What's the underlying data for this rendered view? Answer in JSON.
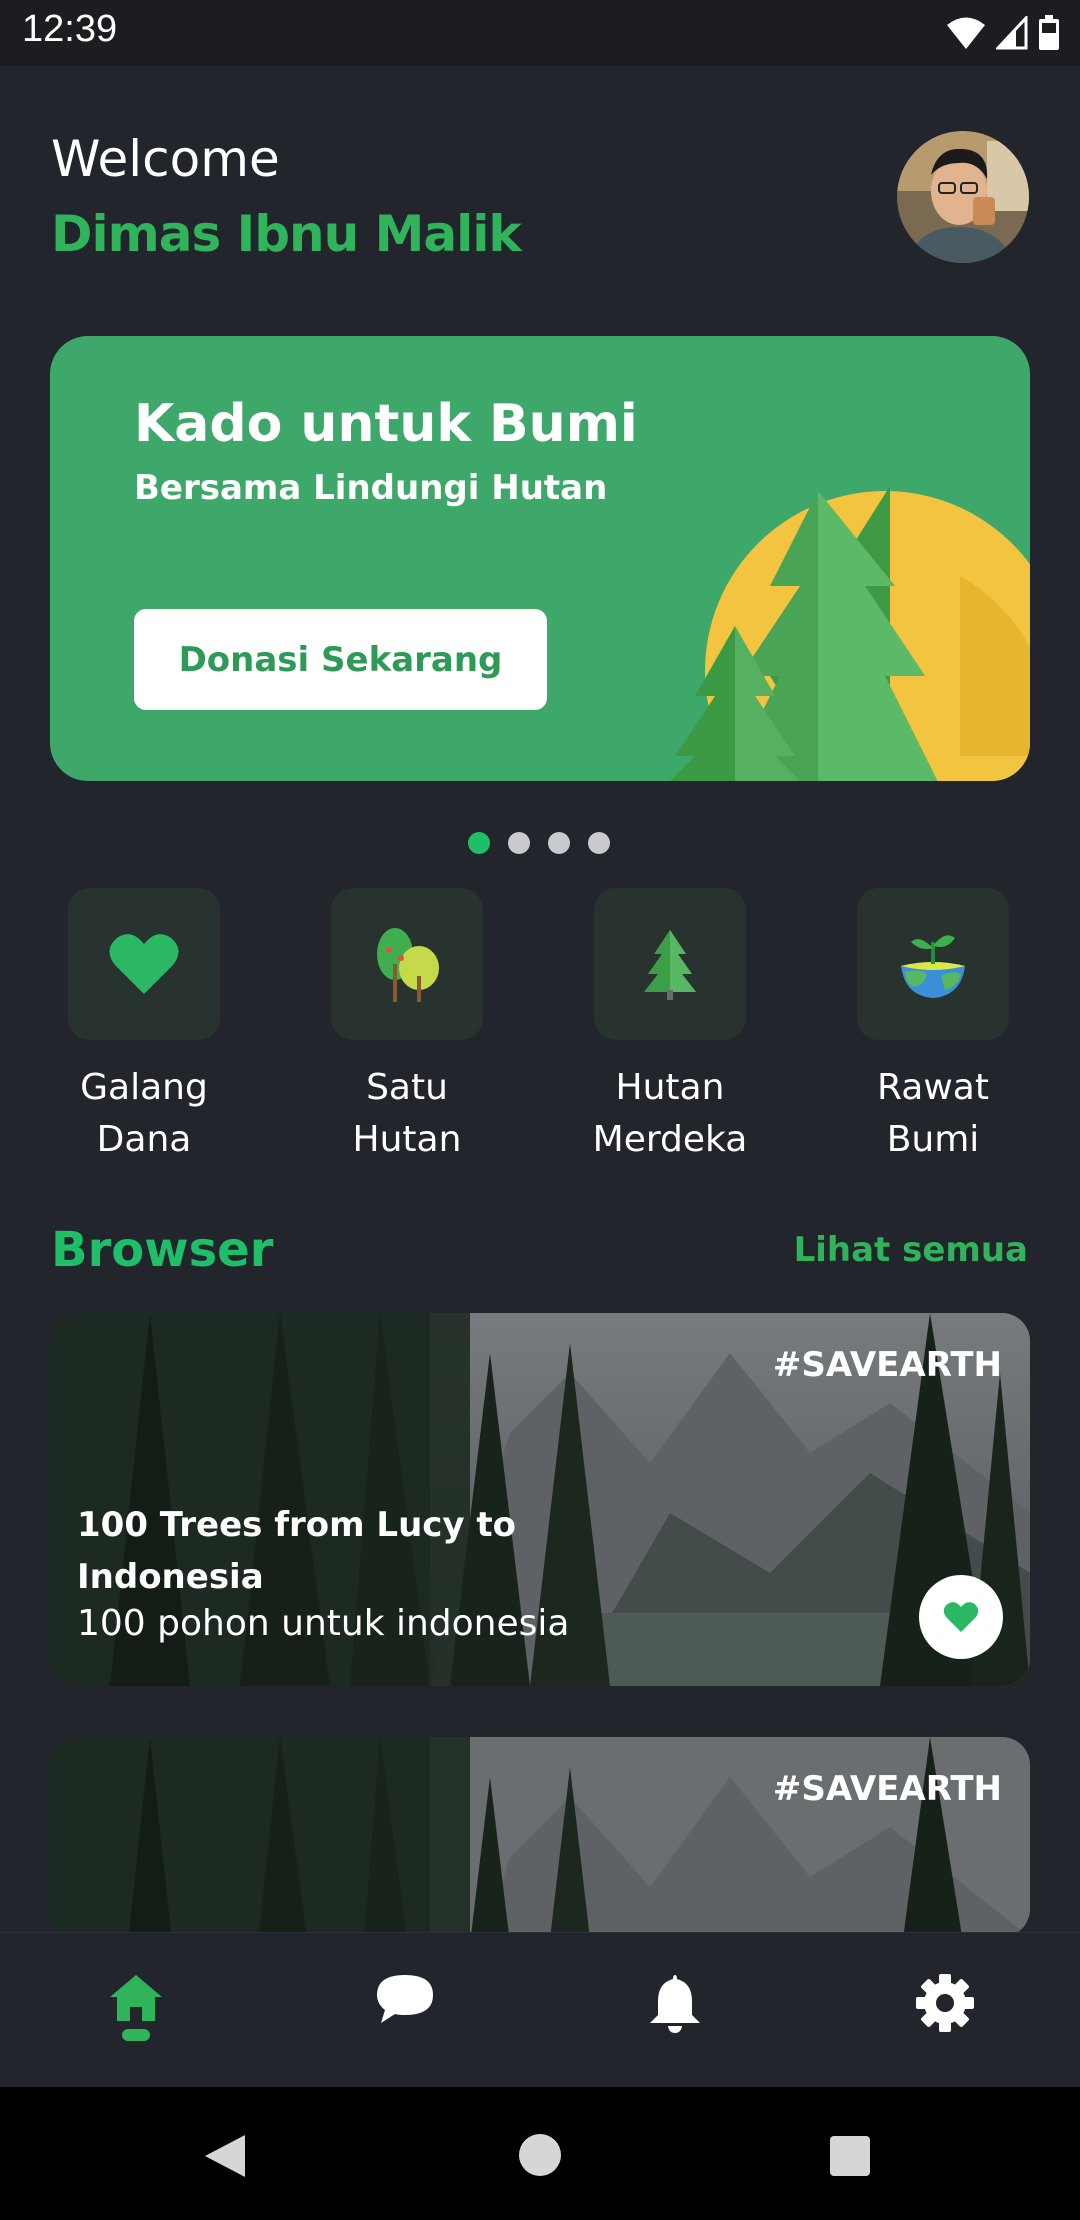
{
  "status": {
    "time": "12:39"
  },
  "header": {
    "greeting": "Welcome",
    "user_name": "Dimas Ibnu Malik"
  },
  "banner": {
    "title": "Kado untuk Bumi",
    "subtitle": "Bersama Lindungi Hutan",
    "button_label": "Donasi Sekarang"
  },
  "carousel": {
    "page_count": 4,
    "active_index": 0
  },
  "categories": [
    {
      "label": "Galang\nDana",
      "icon": "heart-icon"
    },
    {
      "label": "Satu\nHutan",
      "icon": "trees-icon"
    },
    {
      "label": "Hutan\nMerdeka",
      "icon": "pine-tree-icon"
    },
    {
      "label": "Rawat\nBumi",
      "icon": "earth-sprout-icon"
    }
  ],
  "browser": {
    "title": "Browser",
    "see_all": "Lihat semua",
    "cards": [
      {
        "tag": "#SAVEARTH",
        "title": "100 Trees from Lucy to Indonesia",
        "description": "100 pohon untuk indonesia"
      },
      {
        "tag": "#SAVEARTH",
        "title": "",
        "description": ""
      }
    ]
  },
  "bottom_nav": [
    {
      "icon": "home-icon",
      "active": true
    },
    {
      "icon": "chat-icon",
      "active": false
    },
    {
      "icon": "bell-icon",
      "active": false
    },
    {
      "icon": "gear-icon",
      "active": false
    }
  ],
  "colors": {
    "accent": "#1fbf6a",
    "background": "#22252c",
    "banner": "#3ea76a"
  }
}
